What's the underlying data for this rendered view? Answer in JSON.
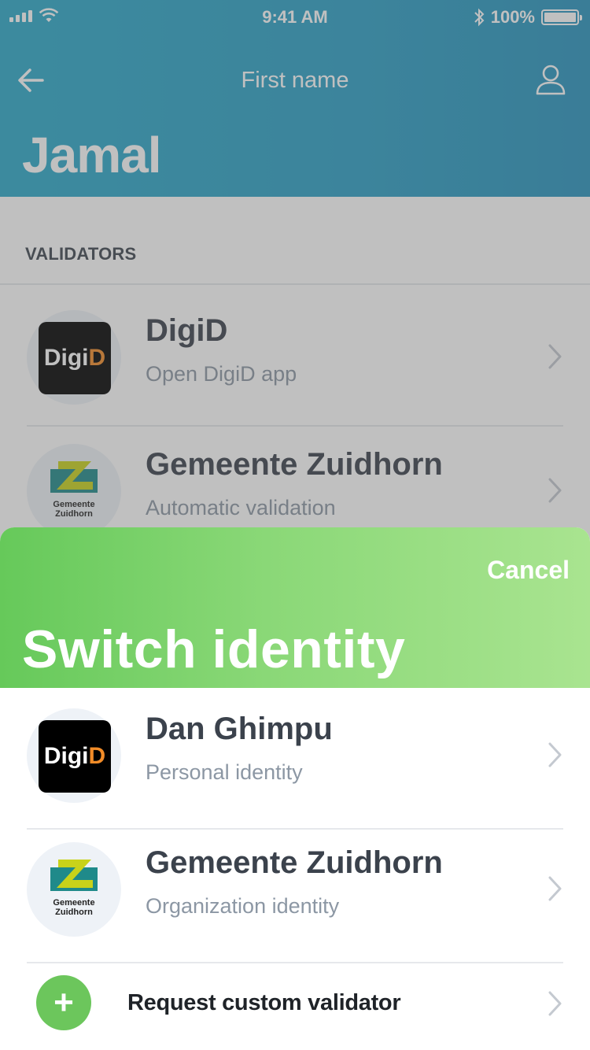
{
  "status_bar": {
    "time": "9:41 AM",
    "battery": "100%"
  },
  "nav": {
    "title": "First name"
  },
  "profile": {
    "name": "Jamal"
  },
  "validators": {
    "section_label": "VALIDATORS",
    "items": [
      {
        "title": "DigiD",
        "subtitle": "Open DigiD app",
        "logo": "DigiD"
      },
      {
        "title": "Gemeente Zuidhorn",
        "subtitle": "Automatic validation",
        "logo": "Gemeente Zuidhorn"
      }
    ]
  },
  "sheet": {
    "cancel_label": "Cancel",
    "title": "Switch identity",
    "identities": [
      {
        "title": "Dan Ghimpu",
        "subtitle": "Personal identity",
        "logo": "DigiD"
      },
      {
        "title": "Gemeente Zuidhorn",
        "subtitle": "Organization identity",
        "logo": "Gemeente Zuidhorn"
      }
    ],
    "request_label": "Request custom validator",
    "request_icon": "+"
  },
  "logos": {
    "digid_prefix": "Digi",
    "digid_suffix": "D",
    "zuidhorn_line1": "Gemeente",
    "zuidhorn_line2": "Zuidhorn"
  },
  "colors": {
    "header": "#2a9fc5",
    "sheet_header": "#8ad877",
    "accent_green": "#6cc65c",
    "digid_orange": "#f28c28"
  },
  "icons": [
    "back-arrow-icon",
    "profile-icon",
    "chevron-right-icon",
    "plus-icon",
    "wifi-icon",
    "bluetooth-icon",
    "battery-icon",
    "signal-icon"
  ]
}
